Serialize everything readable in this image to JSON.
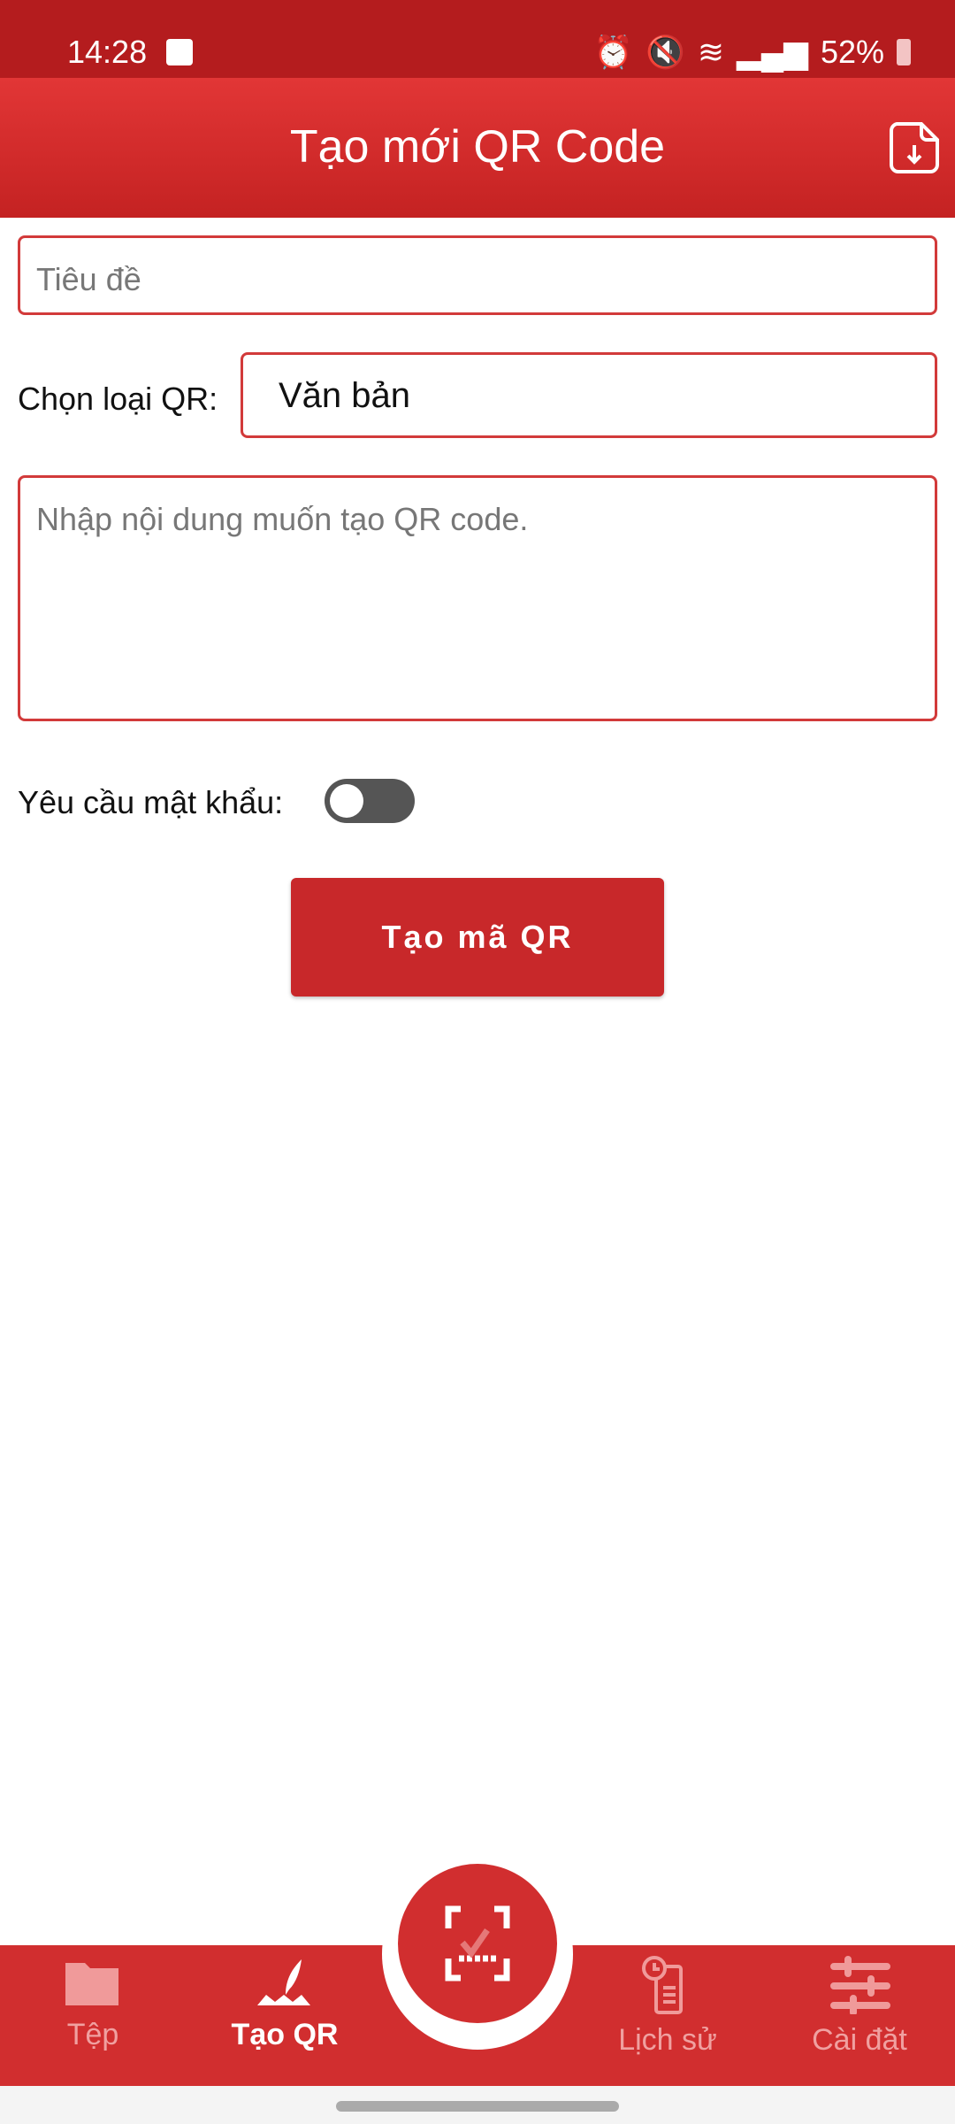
{
  "status": {
    "time": "14:28",
    "battery": "52%"
  },
  "header": {
    "title": "Tạo mới QR Code"
  },
  "form": {
    "title_placeholder": "Tiêu đề",
    "type_label": "Chọn loại QR:",
    "type_value": "Văn bản",
    "content_placeholder": "Nhập nội dung muốn tạo QR code.",
    "password_label": "Yêu cầu mật khẩu:",
    "password_enabled": false,
    "submit_label": "Tạo mã QR"
  },
  "nav": {
    "items": [
      {
        "label": "Tệp"
      },
      {
        "label": "Tạo QR",
        "active": true
      },
      {
        "label": "Lịch sử"
      },
      {
        "label": "Cài đặt"
      }
    ]
  },
  "colors": {
    "primary": "#d12e2f",
    "status": "#b41c1e"
  }
}
